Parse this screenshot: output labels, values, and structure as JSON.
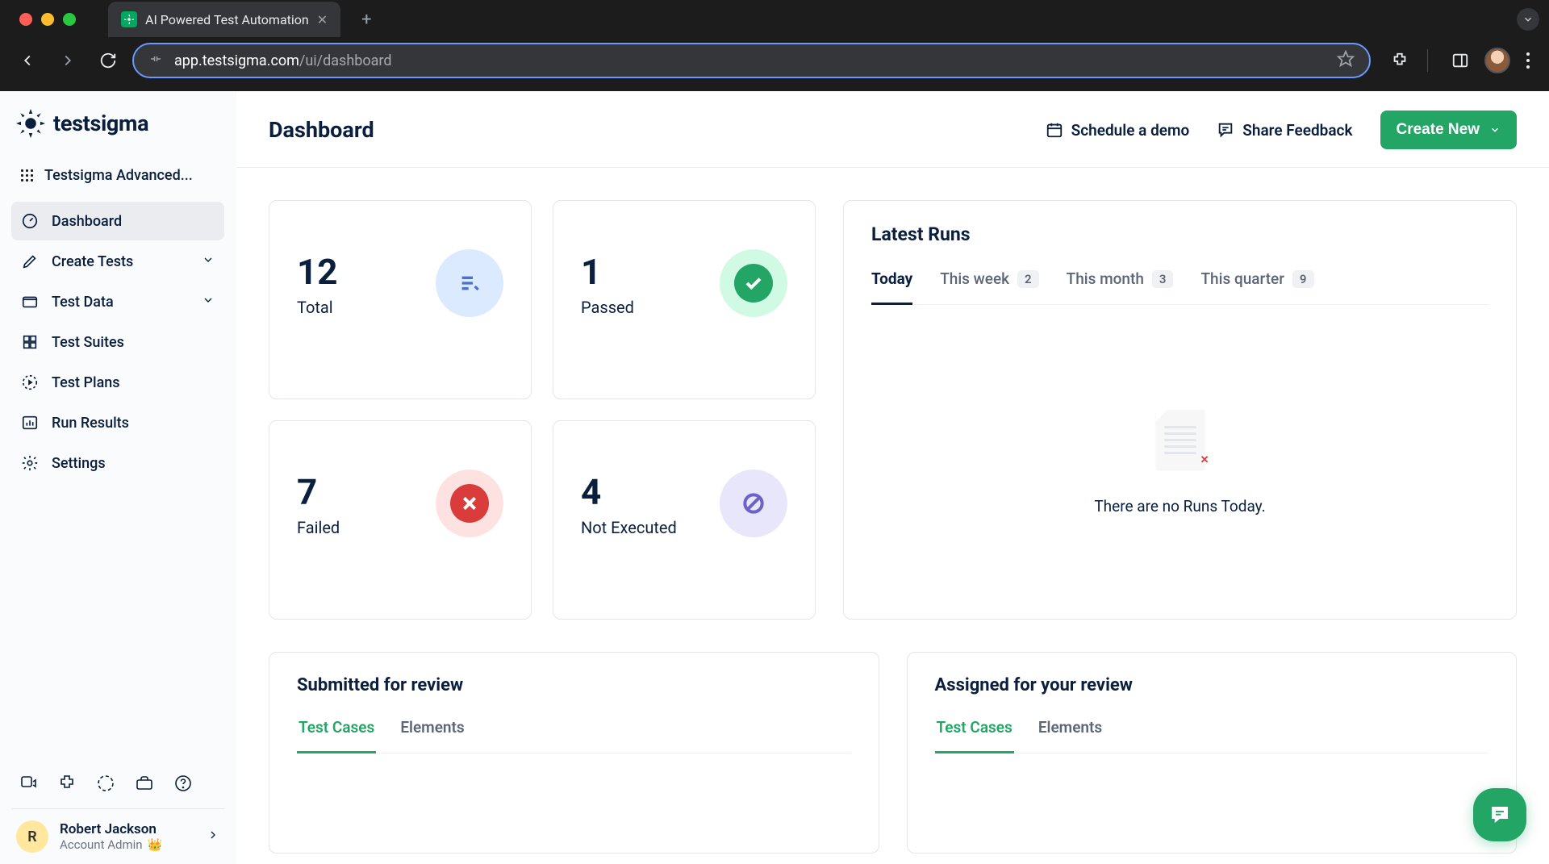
{
  "browser": {
    "tab_title": "AI Powered Test Automation",
    "url_domain": "app.testsigma.com",
    "url_path": "/ui/dashboard"
  },
  "sidebar": {
    "logo_text": "testsigma",
    "project": "Testsigma Advanced...",
    "items": [
      {
        "label": "Dashboard"
      },
      {
        "label": "Create Tests"
      },
      {
        "label": "Test Data"
      },
      {
        "label": "Test Suites"
      },
      {
        "label": "Test Plans"
      },
      {
        "label": "Run Results"
      },
      {
        "label": "Settings"
      }
    ],
    "user": {
      "initial": "R",
      "name": "Robert Jackson",
      "role": "Account Admin"
    }
  },
  "header": {
    "title": "Dashboard",
    "schedule": "Schedule a demo",
    "feedback": "Share Feedback",
    "create": "Create New"
  },
  "stats": {
    "total": {
      "value": "12",
      "label": "Total"
    },
    "passed": {
      "value": "1",
      "label": "Passed"
    },
    "failed": {
      "value": "7",
      "label": "Failed"
    },
    "not_executed": {
      "value": "4",
      "label": "Not Executed"
    }
  },
  "latest_runs": {
    "title": "Latest Runs",
    "tabs": {
      "today": "Today",
      "this_week": {
        "label": "This week",
        "count": "2"
      },
      "this_month": {
        "label": "This month",
        "count": "3"
      },
      "this_quarter": {
        "label": "This quarter",
        "count": "9"
      }
    },
    "empty_text": "There are no Runs Today."
  },
  "review": {
    "submitted": {
      "title": "Submitted for review",
      "tabs": {
        "test_cases": "Test Cases",
        "elements": "Elements"
      }
    },
    "assigned": {
      "title": "Assigned for your review",
      "tabs": {
        "test_cases": "Test Cases",
        "elements": "Elements"
      }
    }
  }
}
